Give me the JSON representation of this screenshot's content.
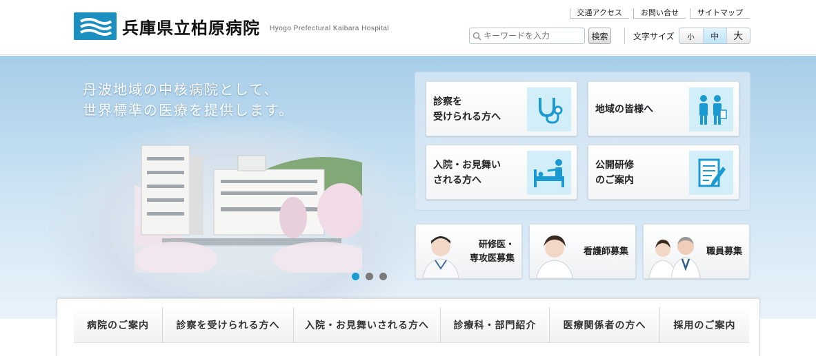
{
  "header": {
    "title": "兵庫県立柏原病院",
    "subtitle": "Hyogo Prefectural Kaibara Hospital",
    "util_links": [
      "交通アクセス",
      "お問い合せ",
      "サイトマップ"
    ],
    "search": {
      "placeholder": "キーワードを入力",
      "button_label": "検索"
    },
    "font_size": {
      "label": "文字サイズ",
      "options": [
        "小",
        "中",
        "大"
      ],
      "selected": "中"
    }
  },
  "hero": {
    "copy_line1": "丹波地域の中核病院として、",
    "copy_line2": "世界標準の医療を提供します。",
    "slides": 3,
    "active_slide": 1
  },
  "cards": [
    {
      "label": "診察を\n受けられる方へ",
      "icon": "stethoscope-icon"
    },
    {
      "label": "地域の皆様へ",
      "icon": "doctor-consult-icon"
    },
    {
      "label": "入院・お見舞い\nされる方へ",
      "icon": "hospital-bed-icon"
    },
    {
      "label": "公開研修\nのご案内",
      "icon": "document-pen-icon"
    }
  ],
  "recruit": [
    {
      "label": "研修医・\n専攻医募集"
    },
    {
      "label": "看護師募集"
    },
    {
      "label": "職員募集"
    }
  ],
  "nav": [
    "病院のご案内",
    "診察を受けられる方へ",
    "入院・お見舞いされる方へ",
    "診療科・部門紹介",
    "医療関係者の方へ",
    "採用のご案内"
  ],
  "colors": {
    "accent": "#1b8fc0",
    "hero_sky": "#a6cde8",
    "icon_bg": "#d2eef8"
  }
}
